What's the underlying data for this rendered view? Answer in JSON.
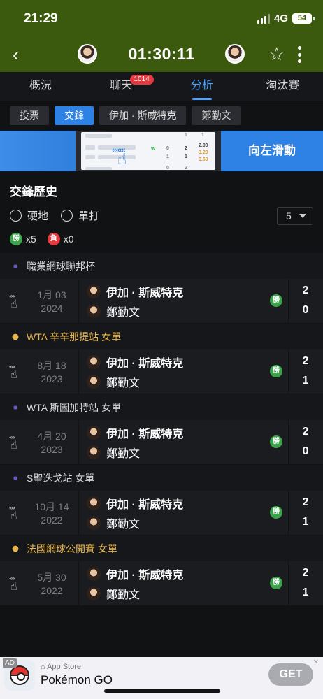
{
  "status": {
    "time": "21:29",
    "network": "4G",
    "battery": "54"
  },
  "header": {
    "timer": "01:30:11"
  },
  "tabs": [
    {
      "label": "概況"
    },
    {
      "label": "聊天",
      "badge": "1014"
    },
    {
      "label": "分析"
    },
    {
      "label": "淘汰賽"
    }
  ],
  "subtabs": [
    {
      "label": "投票"
    },
    {
      "label": "交鋒"
    },
    {
      "label": "伊加 · 斯威特克"
    },
    {
      "label": "鄭勤文"
    }
  ],
  "promo": {
    "button_label": "向左滑動",
    "card": {
      "score_top": "2",
      "score_bottom": "1",
      "zero": "0",
      "one": "1",
      "odd1": "2.00",
      "odd2": "3.20",
      "odd3": "3.60",
      "w": "W",
      "a": "1",
      "b": "1",
      "c": "2",
      "d": "0"
    }
  },
  "h2h": {
    "title": "交鋒歷史",
    "filter_surface": "硬地",
    "filter_singles": "單打",
    "count": "5",
    "wins_label": "勝",
    "wins": "x5",
    "losses_label": "負",
    "losses": "x0"
  },
  "matches": [
    {
      "tournament": "職業網球聯邦杯",
      "tone": "white",
      "date": "1月 03",
      "year": "2024",
      "player1": "伊加 · 斯威特克",
      "player2": "鄭勤文",
      "result": "勝",
      "score1": "2",
      "score2": "0"
    },
    {
      "tournament": "WTA 辛辛那提站 女單",
      "tone": "gold",
      "date": "8月 18",
      "year": "2023",
      "player1": "伊加 · 斯威特克",
      "player2": "鄭勤文",
      "result": "勝",
      "score1": "2",
      "score2": "1"
    },
    {
      "tournament": "WTA 斯圖加特站 女單",
      "tone": "white",
      "date": "4月 20",
      "year": "2023",
      "player1": "伊加 · 斯威特克",
      "player2": "鄭勤文",
      "result": "勝",
      "score1": "2",
      "score2": "0"
    },
    {
      "tournament": "S聖迭戈站 女單",
      "tone": "white",
      "date": "10月 14",
      "year": "2022",
      "player1": "伊加 · 斯威特克",
      "player2": "鄭勤文",
      "result": "勝",
      "score1": "2",
      "score2": "1"
    },
    {
      "tournament": "法國網球公開賽 女單",
      "tone": "gold",
      "date": "5月 30",
      "year": "2022",
      "player1": "伊加 · 斯威特克",
      "player2": "鄭勤文",
      "result": "勝",
      "score1": "2",
      "score2": "1"
    }
  ],
  "ad": {
    "tag": "AD",
    "store": "App Store",
    "name": "Pokémon GO",
    "cta": "GET"
  },
  "colors": {
    "header_bg": "#3b5a0d",
    "accent": "#2f82e5",
    "win": "#3aa34a",
    "loss": "#e5393f",
    "gold": "#e7b64a"
  }
}
